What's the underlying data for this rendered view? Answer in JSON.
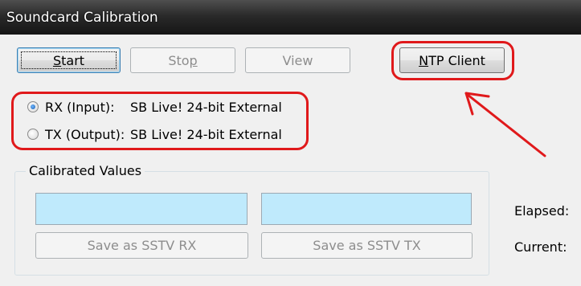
{
  "window": {
    "title": "Soundcard Calibration"
  },
  "buttons": {
    "start": {
      "label_underlined": "S",
      "label_rest": "tart"
    },
    "stop": {
      "label_prefix": "Sto",
      "label_underlined": "p"
    },
    "view": {
      "label": "View"
    },
    "ntp": {
      "label_underlined": "N",
      "label_rest": "TP Client"
    }
  },
  "devices": {
    "rx": {
      "label": "RX (Input):",
      "device": "SB Live! 24-bit External",
      "selected": true
    },
    "tx": {
      "label": "TX (Output):",
      "device": "SB Live! 24-bit External",
      "selected": false
    }
  },
  "calibrated": {
    "title": "Calibrated Values",
    "rx_value": "",
    "tx_value": "",
    "save_rx_label": "Save as SSTV RX",
    "save_tx_label": "Save as SSTV TX"
  },
  "status": {
    "elapsed_label": "Elapsed:",
    "current_label": "Current:"
  },
  "colors": {
    "annotation_red": "#e0191b",
    "field_fill": "#bfeafc",
    "titlebar": "#2a2a2a"
  }
}
